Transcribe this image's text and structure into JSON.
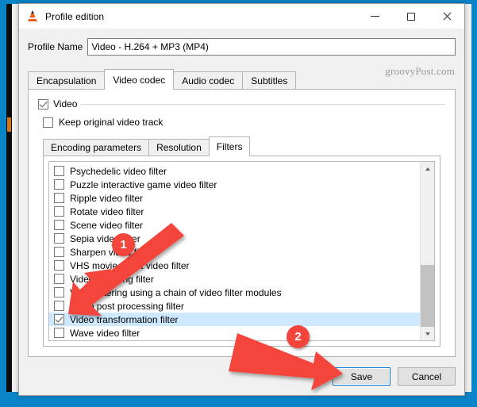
{
  "window": {
    "title": "Profile edition",
    "icon": "vlc-cone-icon",
    "controls": {
      "minimize": "minimize-icon",
      "maximize": "maximize-icon",
      "close": "close-icon"
    }
  },
  "watermark": "groovyPost.com",
  "profile": {
    "label": "Profile Name",
    "value": "Video - H.264 + MP3 (MP4)",
    "placeholder": ""
  },
  "tabs": [
    {
      "label": "Encapsulation",
      "active": false
    },
    {
      "label": "Video codec",
      "active": true
    },
    {
      "label": "Audio codec",
      "active": false
    },
    {
      "label": "Subtitles",
      "active": false
    }
  ],
  "video_panel": {
    "video_group": {
      "label": "Video",
      "checked": true
    },
    "keep_original": {
      "label": "Keep original video track",
      "checked": false
    },
    "inner_tabs": [
      {
        "label": "Encoding parameters",
        "active": false
      },
      {
        "label": "Resolution",
        "active": false
      },
      {
        "label": "Filters",
        "active": true
      }
    ],
    "filters": [
      {
        "label": "Psychedelic video filter",
        "checked": false,
        "selected": false
      },
      {
        "label": "Puzzle interactive game video filter",
        "checked": false,
        "selected": false
      },
      {
        "label": "Ripple video filter",
        "checked": false,
        "selected": false
      },
      {
        "label": "Rotate video filter",
        "checked": false,
        "selected": false
      },
      {
        "label": "Scene video filter",
        "checked": false,
        "selected": false
      },
      {
        "label": "Sepia video filter",
        "checked": false,
        "selected": false
      },
      {
        "label": "Sharpen video filter",
        "checked": false,
        "selected": false
      },
      {
        "label": "VHS movie effect video filter",
        "checked": false,
        "selected": false
      },
      {
        "label": "Video cropping filter",
        "checked": false,
        "selected": false
      },
      {
        "label": "Video filtering using a chain of video filter modules",
        "checked": false,
        "selected": false
      },
      {
        "label": "Video post processing filter",
        "checked": false,
        "selected": false
      },
      {
        "label": "Video transformation filter",
        "checked": true,
        "selected": true
      },
      {
        "label": "Wave video filter",
        "checked": false,
        "selected": false
      }
    ]
  },
  "footer": {
    "save_label": "Save",
    "cancel_label": "Cancel"
  },
  "annotations": {
    "step1": "1",
    "step2": "2",
    "accent_color": "#f4453c"
  },
  "colors": {
    "selection": "#cde8ff",
    "focus_border": "#0078d7",
    "dialog_bg": "#f0f0f0",
    "titlebar_bg": "#ffffff",
    "backdrop_blue": "#0a84c8"
  }
}
